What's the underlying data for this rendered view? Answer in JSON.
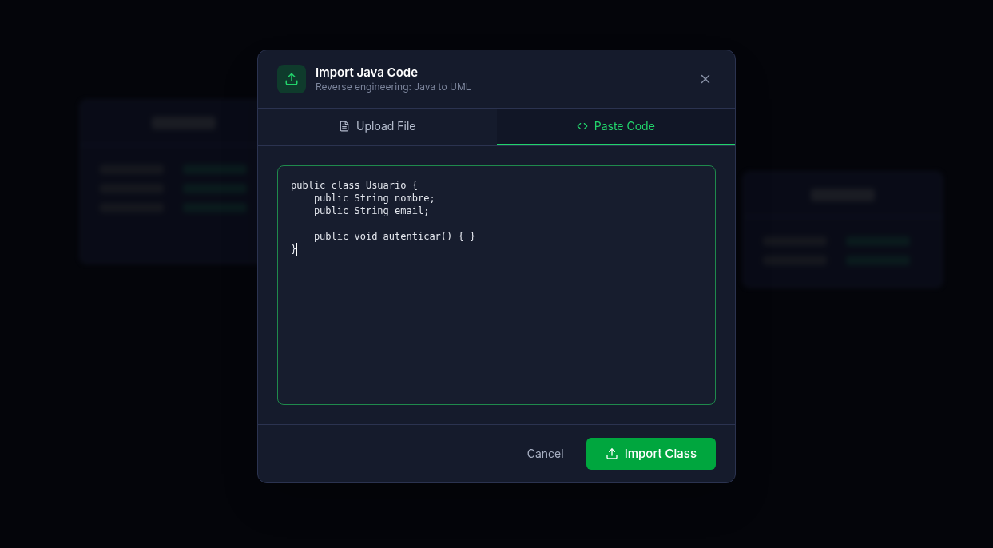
{
  "dialog": {
    "title": "Import Java Code",
    "subtitle": "Reverse engineering: Java to UML"
  },
  "tabs": [
    {
      "label": "Upload File",
      "kind": "file",
      "selected": false
    },
    {
      "label": "Paste Code",
      "kind": "code",
      "selected": true
    }
  ],
  "code_field": {
    "value": "public class Usuario {\n    public String nombre;\n    public String email;\n\n    public void autenticar() { }\n}",
    "focused": true
  },
  "buttons": {
    "cancel": "Cancel",
    "import": "Import Class"
  }
}
